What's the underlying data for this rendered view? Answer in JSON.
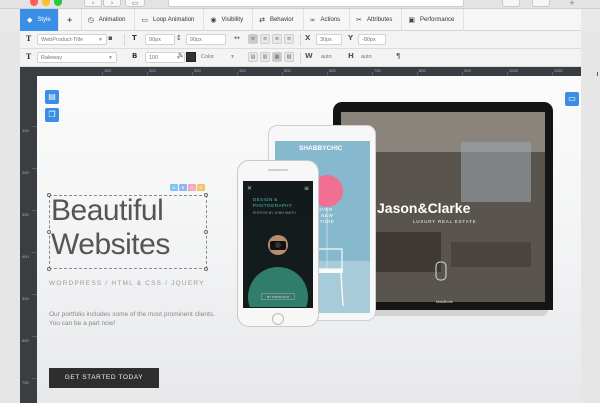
{
  "toolbar": {
    "tabs": [
      {
        "label": "Style",
        "icon": "droplet-icon"
      },
      {
        "label": "",
        "icon": "plus-icon"
      },
      {
        "label": "Animation",
        "icon": "timer-icon"
      },
      {
        "label": "Loop Animation",
        "icon": "loop-icon"
      },
      {
        "label": "Visibility",
        "icon": "eye-icon"
      },
      {
        "label": "Behavior",
        "icon": "behavior-icon"
      },
      {
        "label": "Actions",
        "icon": "link-icon"
      },
      {
        "label": "Attributes",
        "icon": "wrench-icon"
      },
      {
        "label": "Performance",
        "icon": "image-icon"
      }
    ],
    "active_tab": "Style"
  },
  "properties": {
    "row1": {
      "style_select": "WebProduct-Title",
      "font_size": "90px",
      "line_height": "90px",
      "x_value": "30px",
      "y_value": "-80px"
    },
    "row2": {
      "font_family": "Raleway",
      "font_weight": "100",
      "color_value": "Color",
      "width_value": "auto",
      "height_value": "auto"
    }
  },
  "ruler": {
    "top_ticks": [
      "100",
      "200",
      "300",
      "400",
      "500",
      "600",
      "700",
      "800",
      "900",
      "1000",
      "1100",
      "1200"
    ],
    "left_ticks": [
      "100",
      "200",
      "300",
      "400",
      "500",
      "600",
      "700",
      "800"
    ]
  },
  "canvas": {
    "title_line1": "Beautiful",
    "title_line2": "Websites",
    "subtitle": "WORDPRESS / HTML & CSS / JQUERY",
    "desc_line1": "Our portfolio includes some of the most prominent clients.",
    "desc_line2": "You can be a part now!",
    "cta_label": "GET STARTED TODAY",
    "badges": [
      "A",
      "B",
      "C",
      "D"
    ]
  },
  "devices": {
    "laptop_title": "Jason&Clarke",
    "laptop_subtitle": "LUXURY REAL ESTATE",
    "laptop_brand": "MacBook",
    "tablet_brand": "SHABBYCHIC",
    "tablet_lines": [
      "DISCOVER",
      "YOUR NEW",
      "FURNITURE"
    ],
    "phone_heading_1": "DESIGN &",
    "phone_heading_2": "PHOTOGRAPHY",
    "phone_byline": "PHOTOS BY JOHN SMITH",
    "phone_button": "MY PORTFOLIO"
  },
  "colors": {
    "accent": "#3a8ee6",
    "ruler": "#3a3d42",
    "cta": "#2e2e2e",
    "balloon": "#f06f92"
  }
}
